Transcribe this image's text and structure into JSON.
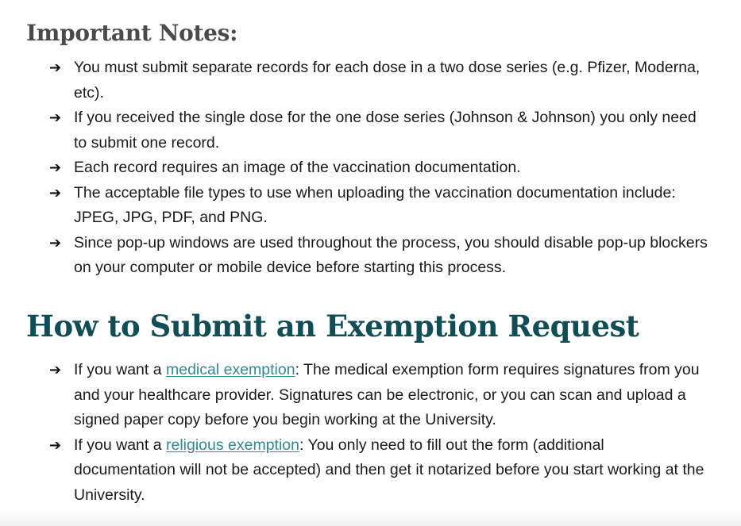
{
  "notes_section": {
    "heading": "Important Notes:",
    "bullet_glyph": "➔",
    "items": [
      "You must submit separate records for each dose in a two dose series (e.g. Pfizer, Moderna, etc).",
      "If you received the single dose for the one dose series (Johnson & Johnson) you only need to submit one record.",
      "Each record requires an image of the vaccination documentation.",
      "The acceptable file types to use when uploading the vaccination documentation include: JPEG, JPG, PDF, and PNG.",
      "Since pop-up windows are used throughout the process, you should disable pop-up blockers on your computer or mobile device before starting this process."
    ]
  },
  "exemption_section": {
    "heading": "How to Submit an Exemption Request",
    "items": [
      {
        "prefix": "If you want a ",
        "link_text": "medical exemption",
        "suffix": ": The medical exemption form requires signatures from you and your healthcare provider. Signatures can be electronic, or you can scan and upload a signed paper copy before you begin working at the University."
      },
      {
        "prefix": "If you want a ",
        "link_text": "religious exemption",
        "suffix": ": You only need to fill out the form (additional documentation will not be accepted) and then get it notarized before you start working at the University."
      }
    ]
  },
  "colors": {
    "notes_heading": "#4a4a4a",
    "section_heading": "#0f4d57",
    "link": "#2e8a96",
    "body_text": "#1a1a1a"
  }
}
